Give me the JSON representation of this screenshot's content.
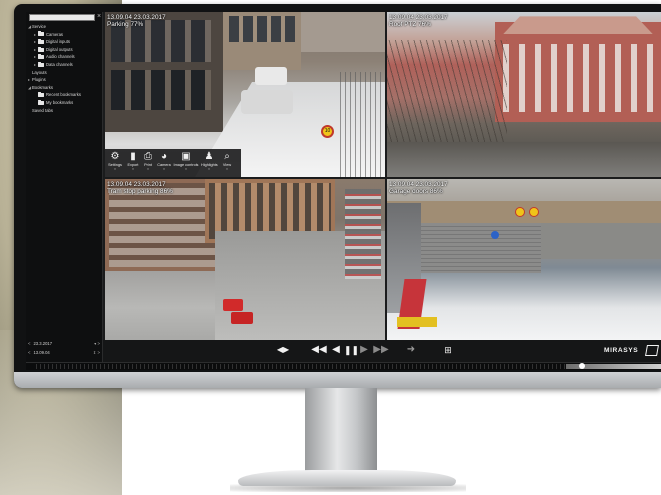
{
  "sidebar": {
    "items": [
      {
        "label": "Service",
        "arrow": "expanded",
        "indent": 0,
        "folder": false
      },
      {
        "label": "Cameras",
        "arrow": "collapsed",
        "indent": 1,
        "folder": true
      },
      {
        "label": "Digital inputs",
        "arrow": "collapsed",
        "indent": 1,
        "folder": true
      },
      {
        "label": "Digital outputs",
        "arrow": "collapsed",
        "indent": 1,
        "folder": true
      },
      {
        "label": "Audio channels",
        "arrow": "collapsed",
        "indent": 1,
        "folder": true
      },
      {
        "label": "Data channels",
        "arrow": "collapsed",
        "indent": 1,
        "folder": true
      },
      {
        "label": "Layouts",
        "arrow": "none",
        "indent": 0,
        "folder": false
      },
      {
        "label": "Plugins",
        "arrow": "collapsed",
        "indent": 0,
        "folder": false
      },
      {
        "label": "Bookmarks",
        "arrow": "expanded",
        "indent": 0,
        "folder": false
      },
      {
        "label": "Recent bookmarks",
        "arrow": "none",
        "indent": 1,
        "folder": true
      },
      {
        "label": "My bookmarks",
        "arrow": "none",
        "indent": 1,
        "folder": true
      },
      {
        "label": "Saved tabs",
        "arrow": "none",
        "indent": 0,
        "folder": false
      }
    ]
  },
  "tiles": [
    {
      "time": "13.09.04  23.03.2017",
      "name": "Parking 77%"
    },
    {
      "time": "13.09.04  23.03.2017",
      "name": "Roof PTZ 76%"
    },
    {
      "time": "13.09.04  23.03.2017",
      "name": "Tram stop parking 86%"
    },
    {
      "time": "13.09.04  23.03.2017",
      "name": "Garage doors 86%"
    }
  ],
  "toolbar": {
    "buttons": [
      {
        "label": "Settings",
        "icon": "gear-icon",
        "glyph": "⚙"
      },
      {
        "label": "Export",
        "icon": "export-icon",
        "glyph": "▮"
      },
      {
        "label": "Print",
        "icon": "printer-icon",
        "glyph": "⎙"
      },
      {
        "label": "Camera",
        "icon": "camera-icon",
        "glyph": "◕"
      },
      {
        "label": "Image controls",
        "icon": "image-controls-icon",
        "glyph": "▣"
      },
      {
        "label": "Highlights",
        "icon": "person-icon",
        "glyph": "♟"
      },
      {
        "label": "View",
        "icon": "search-icon",
        "glyph": "⌕"
      }
    ]
  },
  "playback": {
    "date": "23.3.2017",
    "time": "13.09.04",
    "brand": "MIRASYS",
    "controls": {
      "frame_step": "◀▶",
      "fast_rewind": "◀◀",
      "play_reverse": "◀",
      "pause": "❚❚",
      "play": "▶",
      "fast_forward": "▶▶",
      "go_live": "➜",
      "bookmark": "⊞"
    }
  },
  "colors": {
    "ui_dark": "#151617",
    "sidebar": "#0e0f10",
    "text": "#ffffff",
    "timeline_highlight": "#cfcfcf"
  }
}
